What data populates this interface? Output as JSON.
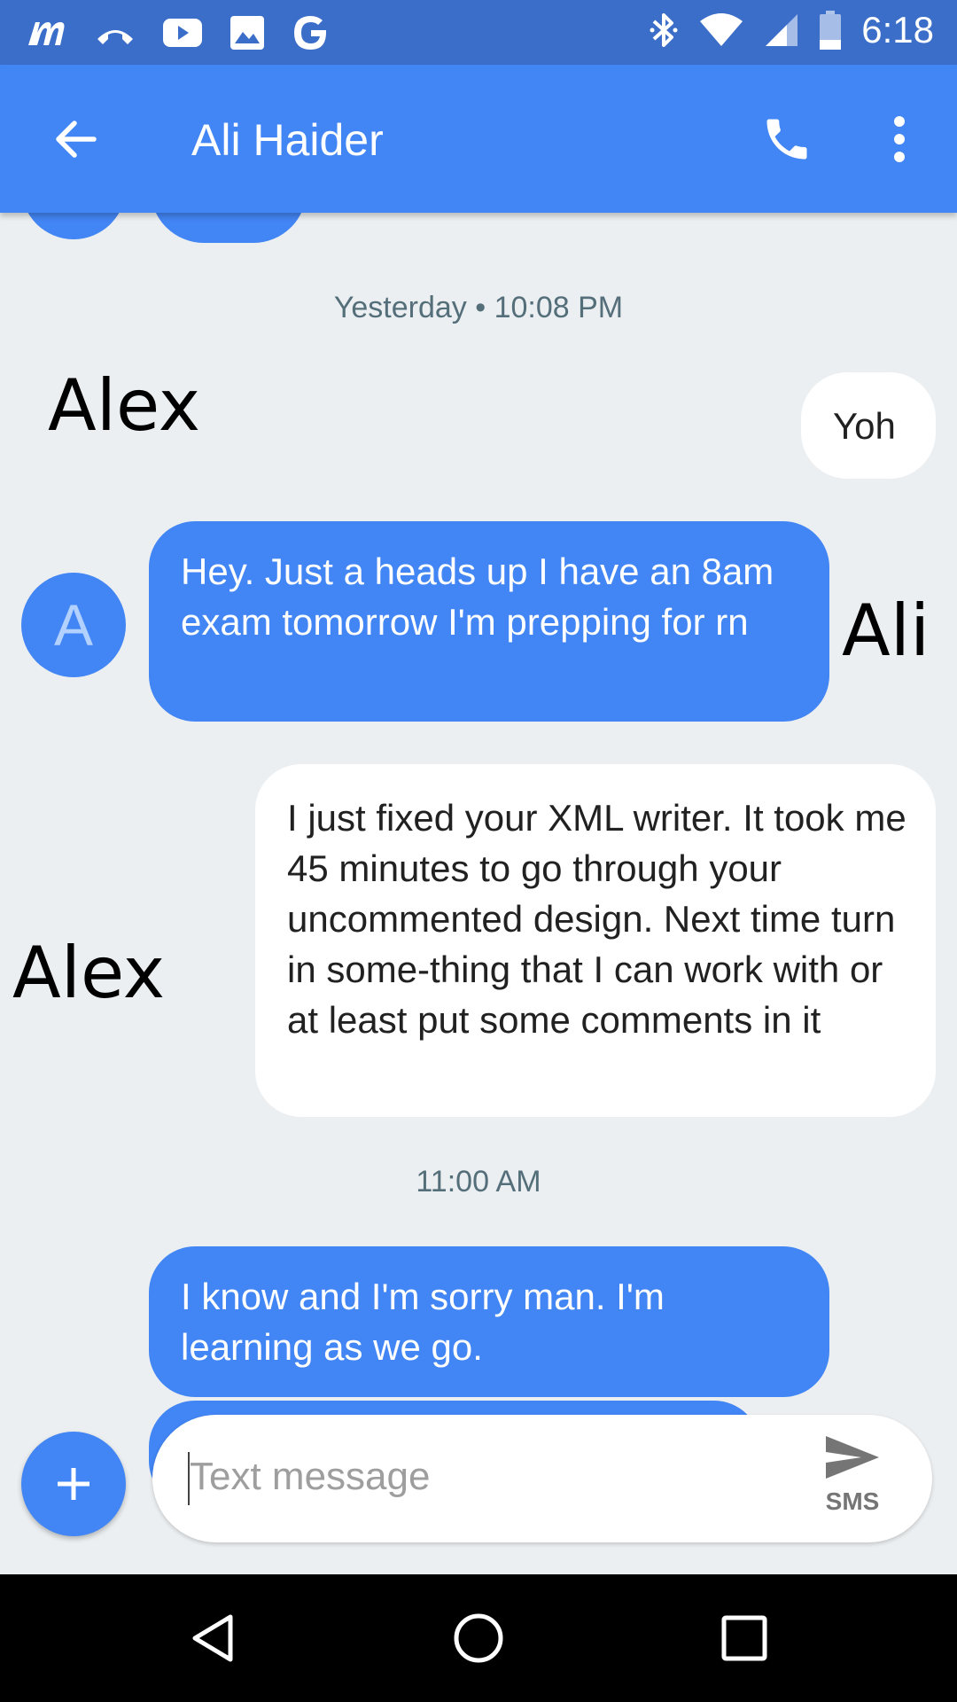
{
  "status_bar": {
    "time": "6:18",
    "left_icons": [
      "messenger-icon",
      "missed-call-icon",
      "youtube-icon",
      "image-icon",
      "google-icon"
    ],
    "right_icons": [
      "bluetooth-icon",
      "wifi-icon",
      "signal-icon",
      "battery-icon"
    ]
  },
  "app_bar": {
    "title": "Ali Haider",
    "back_icon": "arrow-back-icon",
    "call_icon": "phone-icon",
    "menu_icon": "more-vert-icon",
    "color": "#4285f4"
  },
  "conversation": {
    "timestamp_1": "Yesterday • 10:08 PM",
    "timestamp_2": "11:00 AM",
    "messages": [
      {
        "direction": "outgoing",
        "text": "Yoh"
      },
      {
        "direction": "incoming",
        "avatar_letter": "A",
        "text": "Hey. Just a heads up I have an 8am exam tomorrow I'm prepping for rn"
      },
      {
        "direction": "outgoing",
        "text": "I just fixed your XML writer. It took me 45 minutes to go through your uncommented design. Next time turn in some-thing that I can work with or at least put some comments in it"
      },
      {
        "direction": "incoming",
        "text": "I know and I'm sorry man. I'm learning as we go."
      }
    ],
    "annotations": {
      "alex_1": "Alex",
      "ali": "Ali",
      "alex_2": "Alex"
    }
  },
  "compose": {
    "placeholder": "Text message",
    "send_label": "SMS",
    "add_icon": "add-icon",
    "send_icon": "send-icon"
  },
  "nav_bar": {
    "icons": [
      "back-triangle-icon",
      "home-circle-icon",
      "recents-square-icon"
    ]
  }
}
